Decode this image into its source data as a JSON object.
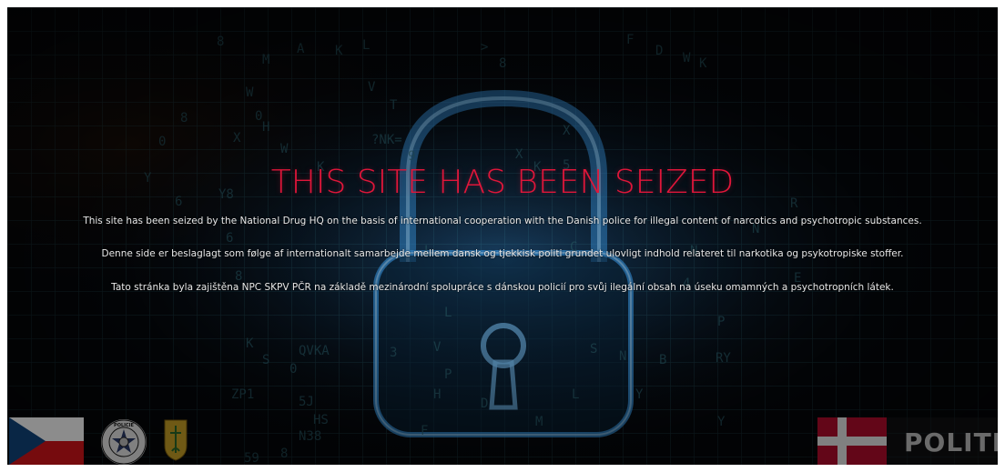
{
  "page": {
    "headline": "THIS SITE HAS BEEN SEIZED",
    "messages": {
      "english": "This site has been seized by the National Drug HQ on the basis of international cooperation with the Danish police for illegal content of narcotics and psychotropic substances.",
      "danish": "Denne side er beslaglagt som følge af internationalt samarbejde mellem dansk og tjekkisk politi grundet ulovligt indhold relateret til narkotika og psykotropiske stoffer.",
      "czech": "Tato stránka byla zajištěna NPC SKPV PČR na základě mezinárodní spolupráce s dánskou policií pro svůj ilegální obsah na úseku omamných a psychotropních látek."
    }
  },
  "footer": {
    "politi_logo_text": "POLITI",
    "police_seal_text": "POLICIE ČESKÉ REPUBLIKY"
  },
  "colors": {
    "headline": "#e0163a",
    "background": "#05070b",
    "lock_glow": "#3fa9ff",
    "grid": "#4fb3c8"
  },
  "icons": {
    "background": "padlock-icon",
    "left_flag": "czech-flag-icon",
    "police_seal": "police-seal-icon",
    "agency_shield": "npc-shield-icon",
    "right_flag": "danish-flag-icon"
  }
}
